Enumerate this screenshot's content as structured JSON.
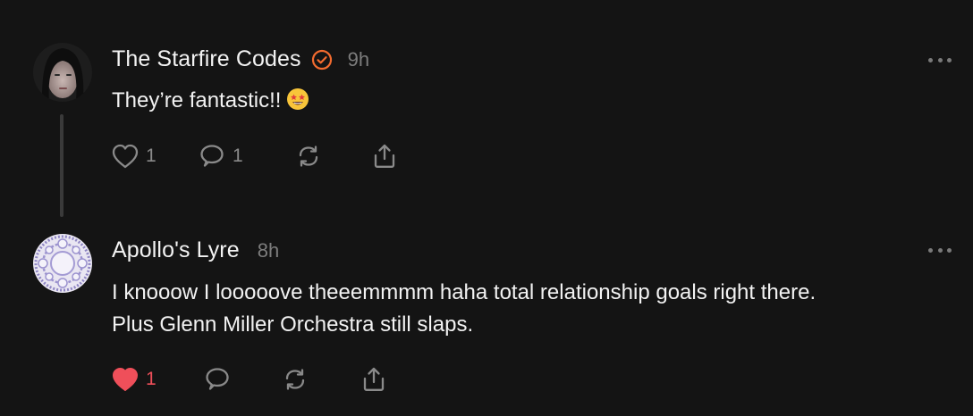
{
  "posts": [
    {
      "author": "The Starfire Codes",
      "verified": true,
      "time": "9h",
      "text": "They’re fantastic!!",
      "emoji": "star-struck-emoji",
      "likes": "1",
      "liked": false,
      "replies": "1"
    },
    {
      "author": "Apollo's Lyre",
      "verified": false,
      "time": "8h",
      "text_line1": "I knooow I looooove theeemmmm haha total relationship goals right there.",
      "text_line2": "Plus Glenn Miller Orchestra still slaps.",
      "likes": "1",
      "liked": true,
      "replies": ""
    }
  ],
  "colors": {
    "background": "#141414",
    "verified_badge": "#f26b2f",
    "liked_heart": "#ef4f5a",
    "icon_gray": "#8a8a8a",
    "thread_line": "#3a3a3a"
  },
  "icons": {
    "like": "heart-icon",
    "reply": "speech-bubble-icon",
    "repost": "repost-arrows-icon",
    "share": "share-upload-icon",
    "more": "more-ellipsis-icon",
    "verified": "verified-badge-icon"
  }
}
